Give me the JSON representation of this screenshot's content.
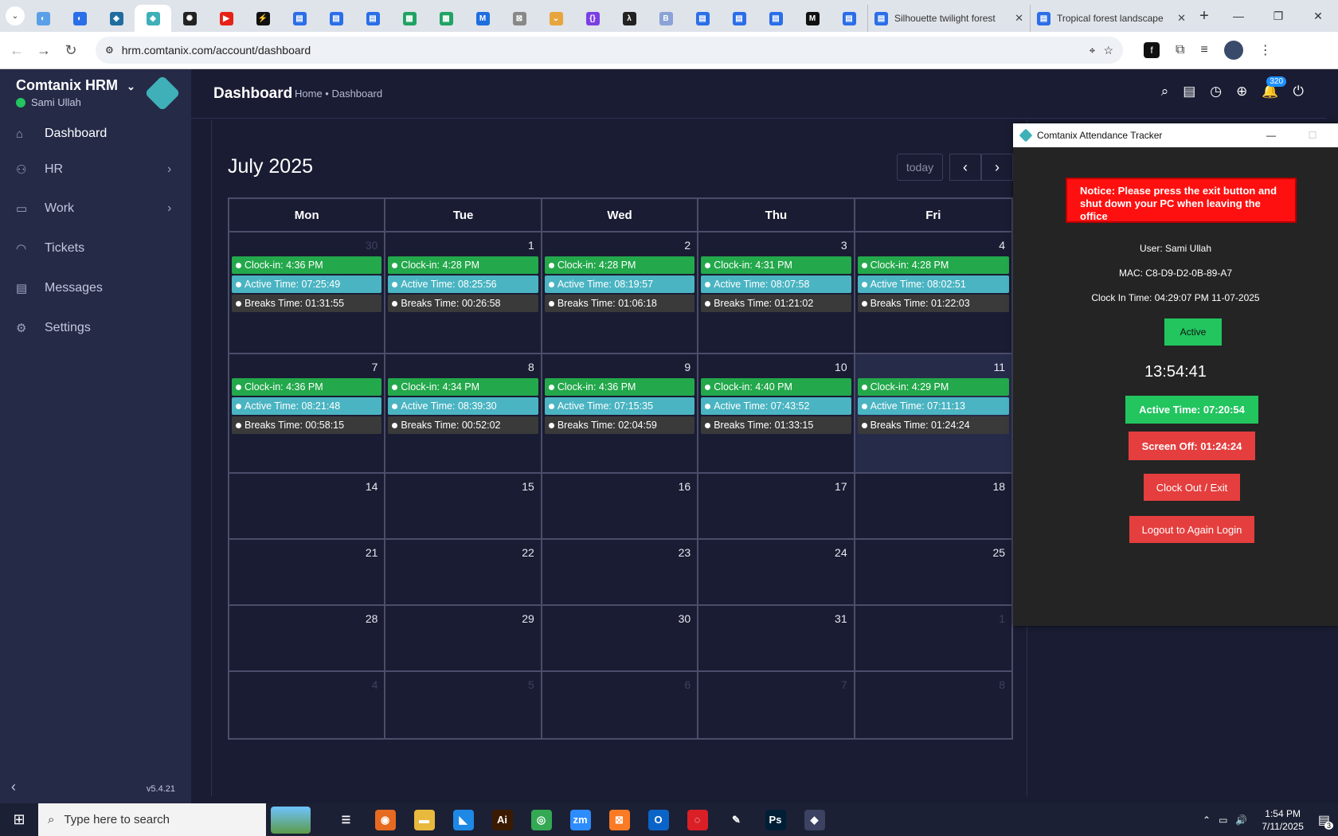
{
  "browser": {
    "tabs": [
      {
        "icon": "drop"
      },
      {
        "icon": "blue-half"
      },
      {
        "icon": "shield"
      },
      {
        "icon": "comtanix",
        "active": true
      },
      {
        "icon": "openai"
      },
      {
        "icon": "youtube"
      },
      {
        "icon": "bolt"
      },
      {
        "icon": "docs"
      },
      {
        "icon": "docs"
      },
      {
        "icon": "docs"
      },
      {
        "icon": "sheets"
      },
      {
        "icon": "sheets"
      },
      {
        "icon": "mj"
      },
      {
        "icon": "grid"
      },
      {
        "icon": "chevron"
      },
      {
        "icon": "braces"
      },
      {
        "icon": "lambda"
      },
      {
        "icon": "bepo"
      },
      {
        "icon": "forms"
      },
      {
        "icon": "forms"
      },
      {
        "icon": "forms"
      },
      {
        "icon": "M"
      },
      {
        "icon": "forms"
      }
    ],
    "long_tabs": [
      {
        "title": "Silhouette twilight forest"
      },
      {
        "title": "Tropical forest landscape"
      }
    ],
    "url": "hrm.comtanix.com/account/dashboard"
  },
  "sidebar": {
    "brand": "Comtanix HRM",
    "user": "Sami Ullah",
    "items": [
      {
        "label": "Dashboard",
        "icon": "home-icon",
        "arrow": false,
        "active": true
      },
      {
        "label": "HR",
        "icon": "users-icon",
        "arrow": true
      },
      {
        "label": "Work",
        "icon": "briefcase-icon",
        "arrow": true
      },
      {
        "label": "Tickets",
        "icon": "headset-icon",
        "arrow": false
      },
      {
        "label": "Messages",
        "icon": "message-icon",
        "arrow": false
      },
      {
        "label": "Settings",
        "icon": "gear-icon",
        "arrow": false
      }
    ],
    "version": "v5.4.21"
  },
  "header": {
    "title": "Dashboard",
    "breadcrumb": "Home • Dashboard",
    "notif_count": "320"
  },
  "calendar": {
    "month": "July 2025",
    "today_label": "today",
    "days": [
      "Mon",
      "Tue",
      "Wed",
      "Thu",
      "Fri"
    ],
    "weeks": [
      [
        {
          "n": "30",
          "other": true,
          "ev": [
            "Clock-in: 4:36 PM",
            "Active Time: 07:25:49",
            "Breaks Time: 01:31:55"
          ]
        },
        {
          "n": "1",
          "ev": [
            "Clock-in: 4:28 PM",
            "Active Time: 08:25:56",
            "Breaks Time: 00:26:58"
          ]
        },
        {
          "n": "2",
          "ev": [
            "Clock-in: 4:28 PM",
            "Active Time: 08:19:57",
            "Breaks Time: 01:06:18"
          ]
        },
        {
          "n": "3",
          "ev": [
            "Clock-in: 4:31 PM",
            "Active Time: 08:07:58",
            "Breaks Time: 01:21:02"
          ]
        },
        {
          "n": "4",
          "ev": [
            "Clock-in: 4:28 PM",
            "Active Time: 08:02:51",
            "Breaks Time: 01:22:03"
          ]
        }
      ],
      [
        {
          "n": "7",
          "ev": [
            "Clock-in: 4:36 PM",
            "Active Time: 08:21:48",
            "Breaks Time: 00:58:15"
          ]
        },
        {
          "n": "8",
          "ev": [
            "Clock-in: 4:34 PM",
            "Active Time: 08:39:30",
            "Breaks Time: 00:52:02"
          ]
        },
        {
          "n": "9",
          "ev": [
            "Clock-in: 4:36 PM",
            "Active Time: 07:15:35",
            "Breaks Time: 02:04:59"
          ]
        },
        {
          "n": "10",
          "ev": [
            "Clock-in: 4:40 PM",
            "Active Time: 07:43:52",
            "Breaks Time: 01:33:15"
          ]
        },
        {
          "n": "11",
          "today": true,
          "ev": [
            "Clock-in: 4:29 PM",
            "Active Time: 07:11:13",
            "Breaks Time: 01:24:24"
          ]
        }
      ],
      [
        {
          "n": "14"
        },
        {
          "n": "15"
        },
        {
          "n": "16"
        },
        {
          "n": "17"
        },
        {
          "n": "18"
        }
      ],
      [
        {
          "n": "21"
        },
        {
          "n": "22"
        },
        {
          "n": "23"
        },
        {
          "n": "24"
        },
        {
          "n": "25"
        }
      ],
      [
        {
          "n": "28"
        },
        {
          "n": "29"
        },
        {
          "n": "30"
        },
        {
          "n": "31"
        },
        {
          "n": "1",
          "other": true
        }
      ],
      [
        {
          "n": "4",
          "other": true
        },
        {
          "n": "5",
          "other": true
        },
        {
          "n": "6",
          "other": true
        },
        {
          "n": "7",
          "other": true
        },
        {
          "n": "8",
          "other": true
        }
      ]
    ]
  },
  "tracker": {
    "title": "Comtanix Attendance Tracker",
    "notice": "Notice: Please press the exit button and shut down your PC when leaving the office",
    "user": "User: Sami Ullah",
    "mac": "MAC: C8-D9-D2-0B-89-A7",
    "clock_in": "Clock In Time: 04:29:07 PM 11-07-2025",
    "status": "Active",
    "clock": "13:54:41",
    "active_time": "Active Time: 07:20:54",
    "screen_off": "Screen Off: 01:24:24",
    "clock_out": "Clock Out / Exit",
    "logout": "Logout to Again Login"
  },
  "taskbar": {
    "search_placeholder": "Type here to search",
    "time": "1:54 PM",
    "date": "7/11/2025",
    "notif": "3"
  },
  "colors": {
    "green": "#23a84b",
    "teal": "#4ab4c2",
    "dark": "#3a3a3a",
    "red": "#e53e3e"
  }
}
